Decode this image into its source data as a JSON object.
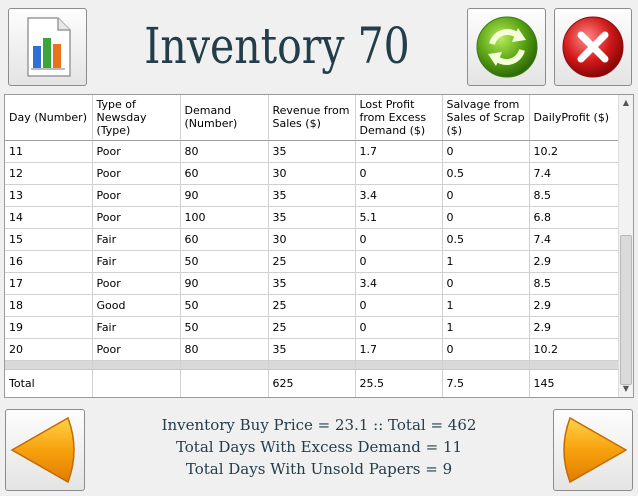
{
  "title": "Inventory 70",
  "icons": {
    "chart": "bar-chart-document-icon",
    "refresh": "refresh-arrows-icon",
    "close": "close-x-icon",
    "prev": "arrow-left-icon",
    "next": "arrow-right-icon"
  },
  "colors": {
    "title": "#233d4b",
    "refresh_green": "#5aa314",
    "close_red": "#d21a1a",
    "arrow_orange": "#f7a10c"
  },
  "table": {
    "headers": [
      "Day (Number)",
      "Type of Newsday (Type)",
      "Demand (Number)",
      "Revenue from Sales ($)",
      "Lost Profit from Excess Demand ($)",
      "Salvage from Sales of Scrap ($)",
      "DailyProfit ($)"
    ],
    "rows": [
      [
        "11",
        "Poor",
        "80",
        "35",
        "1.7",
        "0",
        "10.2"
      ],
      [
        "12",
        "Poor",
        "60",
        "30",
        "0",
        "0.5",
        "7.4"
      ],
      [
        "13",
        "Poor",
        "90",
        "35",
        "3.4",
        "0",
        "8.5"
      ],
      [
        "14",
        "Poor",
        "100",
        "35",
        "5.1",
        "0",
        "6.8"
      ],
      [
        "15",
        "Fair",
        "60",
        "30",
        "0",
        "0.5",
        "7.4"
      ],
      [
        "16",
        "Fair",
        "50",
        "25",
        "0",
        "1",
        "2.9"
      ],
      [
        "17",
        "Poor",
        "90",
        "35",
        "3.4",
        "0",
        "8.5"
      ],
      [
        "18",
        "Good",
        "50",
        "25",
        "0",
        "1",
        "2.9"
      ],
      [
        "19",
        "Fair",
        "50",
        "25",
        "0",
        "1",
        "2.9"
      ],
      [
        "20",
        "Poor",
        "80",
        "35",
        "1.7",
        "0",
        "10.2"
      ]
    ],
    "total": [
      "Total",
      "",
      "",
      "625",
      "25.5",
      "7.5",
      "145"
    ]
  },
  "summary": {
    "line1": "Inventory Buy Price = 23.1 :: Total = 462",
    "line2": "Total Days With Excess Demand = 11",
    "line3": "Total Days With Unsold Papers = 9"
  }
}
